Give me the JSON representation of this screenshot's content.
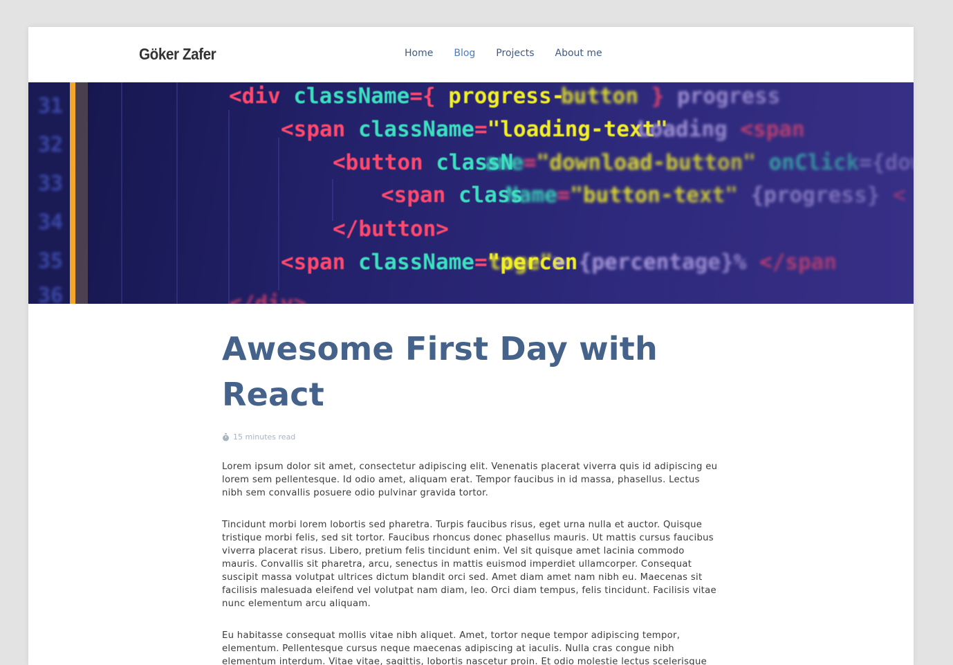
{
  "site": {
    "logo": "Göker Zafer"
  },
  "nav": {
    "items": [
      {
        "label": "Home"
      },
      {
        "label": "Blog"
      },
      {
        "label": "Projects"
      },
      {
        "label": "About me"
      }
    ],
    "active": "Blog"
  },
  "hero": {
    "code_lines": [
      {
        "tag": "<div",
        "attr": "className",
        "rest": "={ progress-button"
      },
      {
        "tag": "<span",
        "attr": "className",
        "rest": "=\"loading-text\" Loading"
      },
      {
        "tag": "<button",
        "attr": "className",
        "rest": "=\"download-button\""
      },
      {
        "tag": "<span",
        "attr": "className",
        "rest": "=\"button-text\""
      },
      {
        "tag": "</button>",
        "attr": "",
        "rest": ""
      },
      {
        "tag": "<span",
        "attr": "className",
        "rest": "=\"percentage\" {percentage}"
      }
    ]
  },
  "post": {
    "title": "Awesome First Day with React",
    "read_time": "15 minutes read",
    "read_icon": "stopwatch-icon",
    "paragraphs": [
      "Lorem ipsum dolor sit amet, consectetur adipiscing elit. Venenatis placerat viverra quis id adipiscing eu lorem sem pellentesque. Id odio amet, aliquam erat. Tempor faucibus in id massa, phasellus. Lectus nibh sem convallis posuere odio pulvinar gravida tortor.",
      "Tincidunt morbi lorem lobortis sed pharetra. Turpis faucibus risus, eget urna nulla et auctor. Quisque tristique morbi felis, sed sit tortor. Faucibus rhoncus donec phasellus mauris. Ut mattis cursus faucibus viverra placerat risus. Libero, pretium felis tincidunt enim. Vel sit quisque amet lacinia commodo mauris. Convallis sit pharetra, arcu, senectus in mattis euismod imperdiet ullamcorper. Consequat suscipit massa volutpat ultrices dictum blandit orci sed. Amet diam amet nam nibh eu. Maecenas sit facilisis malesuada eleifend vel volutpat nam diam, leo. Orci diam tempus, felis tincidunt. Facilisis vitae nunc elementum arcu aliquam.",
      "Eu habitasse consequat mollis vitae nibh aliquet. Amet, tortor neque tempor adipiscing tempor, elementum. Pellentesque cursus neque maecenas adipiscing at iaculis. Nulla cras congue nibh elementum interdum. Vitae vitae, sagittis, lobortis nascetur proin. Et odio molestie lectus scelerisque"
    ]
  },
  "colors": {
    "background": "#e3e3e3",
    "title": "#44628a",
    "nav": "#3f5a80",
    "nav_active": "#4a7cc0",
    "code_tag": "#ff4a6e",
    "code_attr": "#3de0c0",
    "code_string": "#f2ef2a"
  }
}
